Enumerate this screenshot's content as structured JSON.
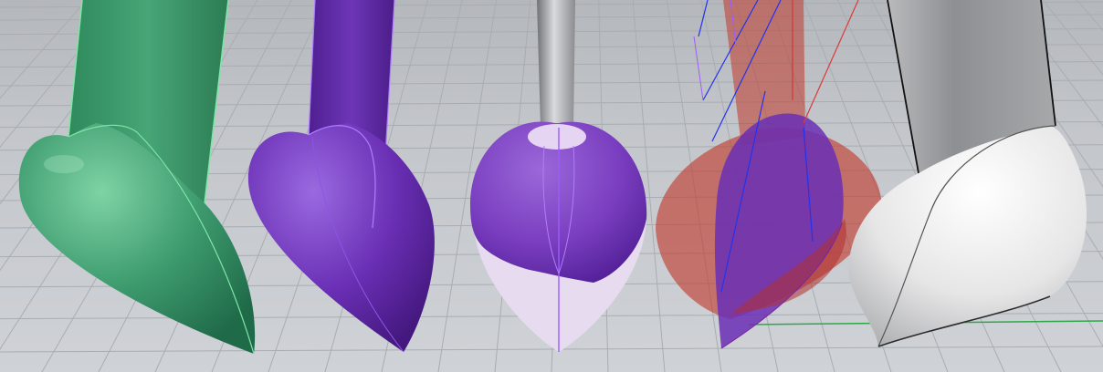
{
  "viewport": {
    "name": "Perspective",
    "background_color": "#c6c9cd",
    "grid_line_color": "#a9adb2",
    "world_x_axis_color": "#d93b3b",
    "world_y_axis_color": "#2fa84a"
  },
  "objects": [
    {
      "id": "green-lofted-bulb",
      "display_mode": "shaded",
      "color": "#3f9d70",
      "edge_color": "#7fe6a6"
    },
    {
      "id": "purple-lofted-bulb",
      "display_mode": "shaded",
      "color": "#6a2fb5",
      "edge_color": "#b07cff"
    },
    {
      "id": "purple-bulb-with-white-intersection",
      "display_mode": "shaded",
      "color": "#7a3ec0",
      "secondary_color": "#e6dbef"
    },
    {
      "id": "red-and-purple-overlap-bulb",
      "display_mode": "ghosted",
      "color": "#c0392b",
      "secondary_color": "#6a2fb5",
      "curve_color": "#2233ee"
    },
    {
      "id": "white-lofted-bulb",
      "display_mode": "shaded",
      "color": "#e9e9ea",
      "edge_color": "#111111"
    }
  ]
}
